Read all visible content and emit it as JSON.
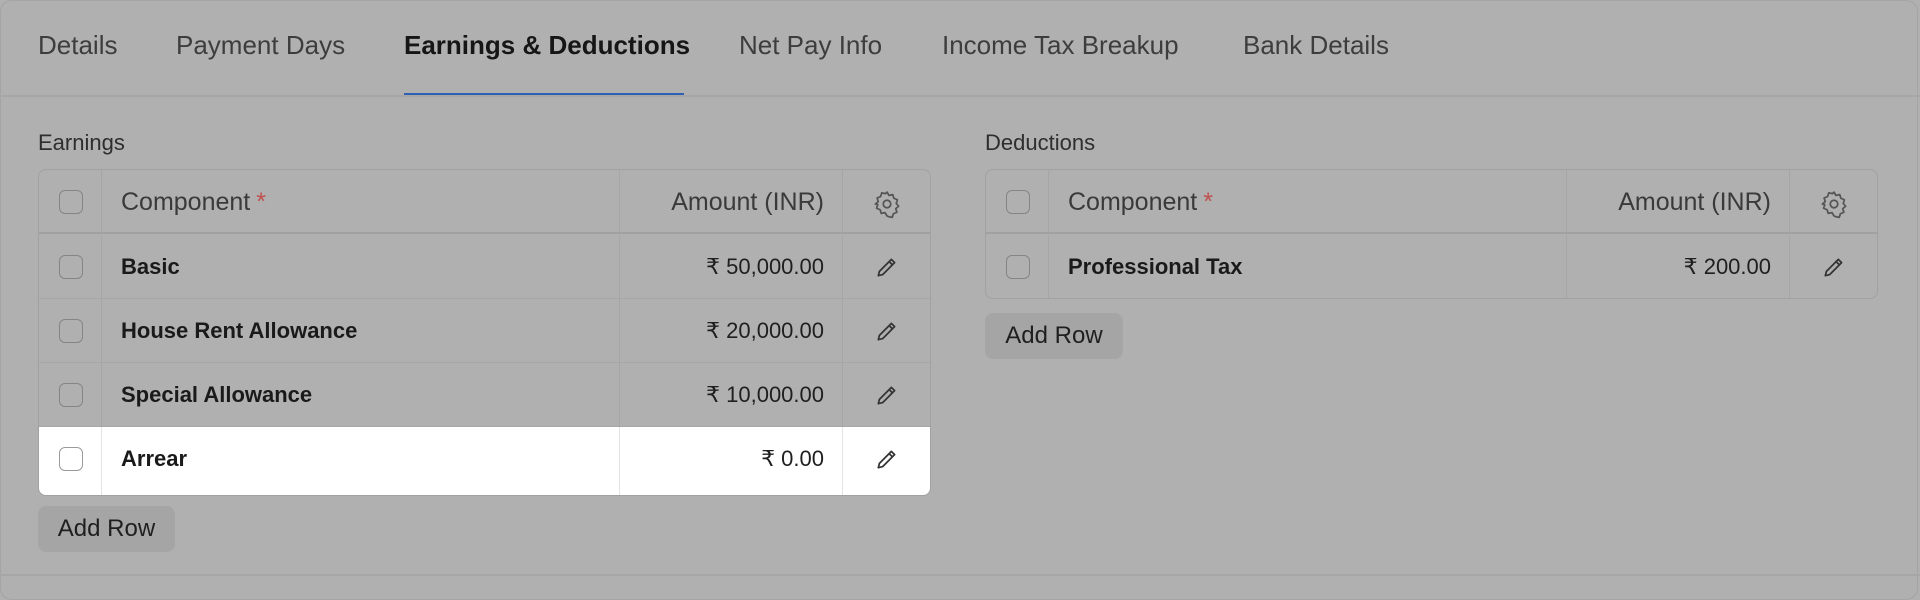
{
  "tabs": [
    {
      "label": "Details",
      "active": false
    },
    {
      "label": "Payment Days",
      "active": false
    },
    {
      "label": "Earnings & Deductions",
      "active": true
    },
    {
      "label": "Net Pay Info",
      "active": false
    },
    {
      "label": "Income Tax Breakup",
      "active": false
    },
    {
      "label": "Bank Details",
      "active": false
    }
  ],
  "earnings": {
    "title": "Earnings",
    "columns": {
      "component": "Component",
      "required_mark": "*",
      "amount": "Amount (INR)"
    },
    "rows": [
      {
        "component": "Basic",
        "amount": "₹ 50,000.00"
      },
      {
        "component": "House Rent Allowance",
        "amount": "₹ 20,000.00"
      },
      {
        "component": "Special Allowance",
        "amount": "₹ 10,000.00"
      },
      {
        "component": "Arrear",
        "amount": "₹ 0.00",
        "highlighted": true
      }
    ],
    "add_row_label": "Add Row"
  },
  "deductions": {
    "title": "Deductions",
    "columns": {
      "component": "Component",
      "required_mark": "*",
      "amount": "Amount (INR)"
    },
    "rows": [
      {
        "component": "Professional Tax",
        "amount": "₹ 200.00"
      }
    ],
    "add_row_label": "Add Row"
  },
  "icons": {
    "settings": "gear-icon",
    "edit": "pencil-icon"
  },
  "colors": {
    "active_tab_underline": "#2f62b5",
    "required_mark": "#c0504d",
    "highlight_row": "#ffffff"
  }
}
